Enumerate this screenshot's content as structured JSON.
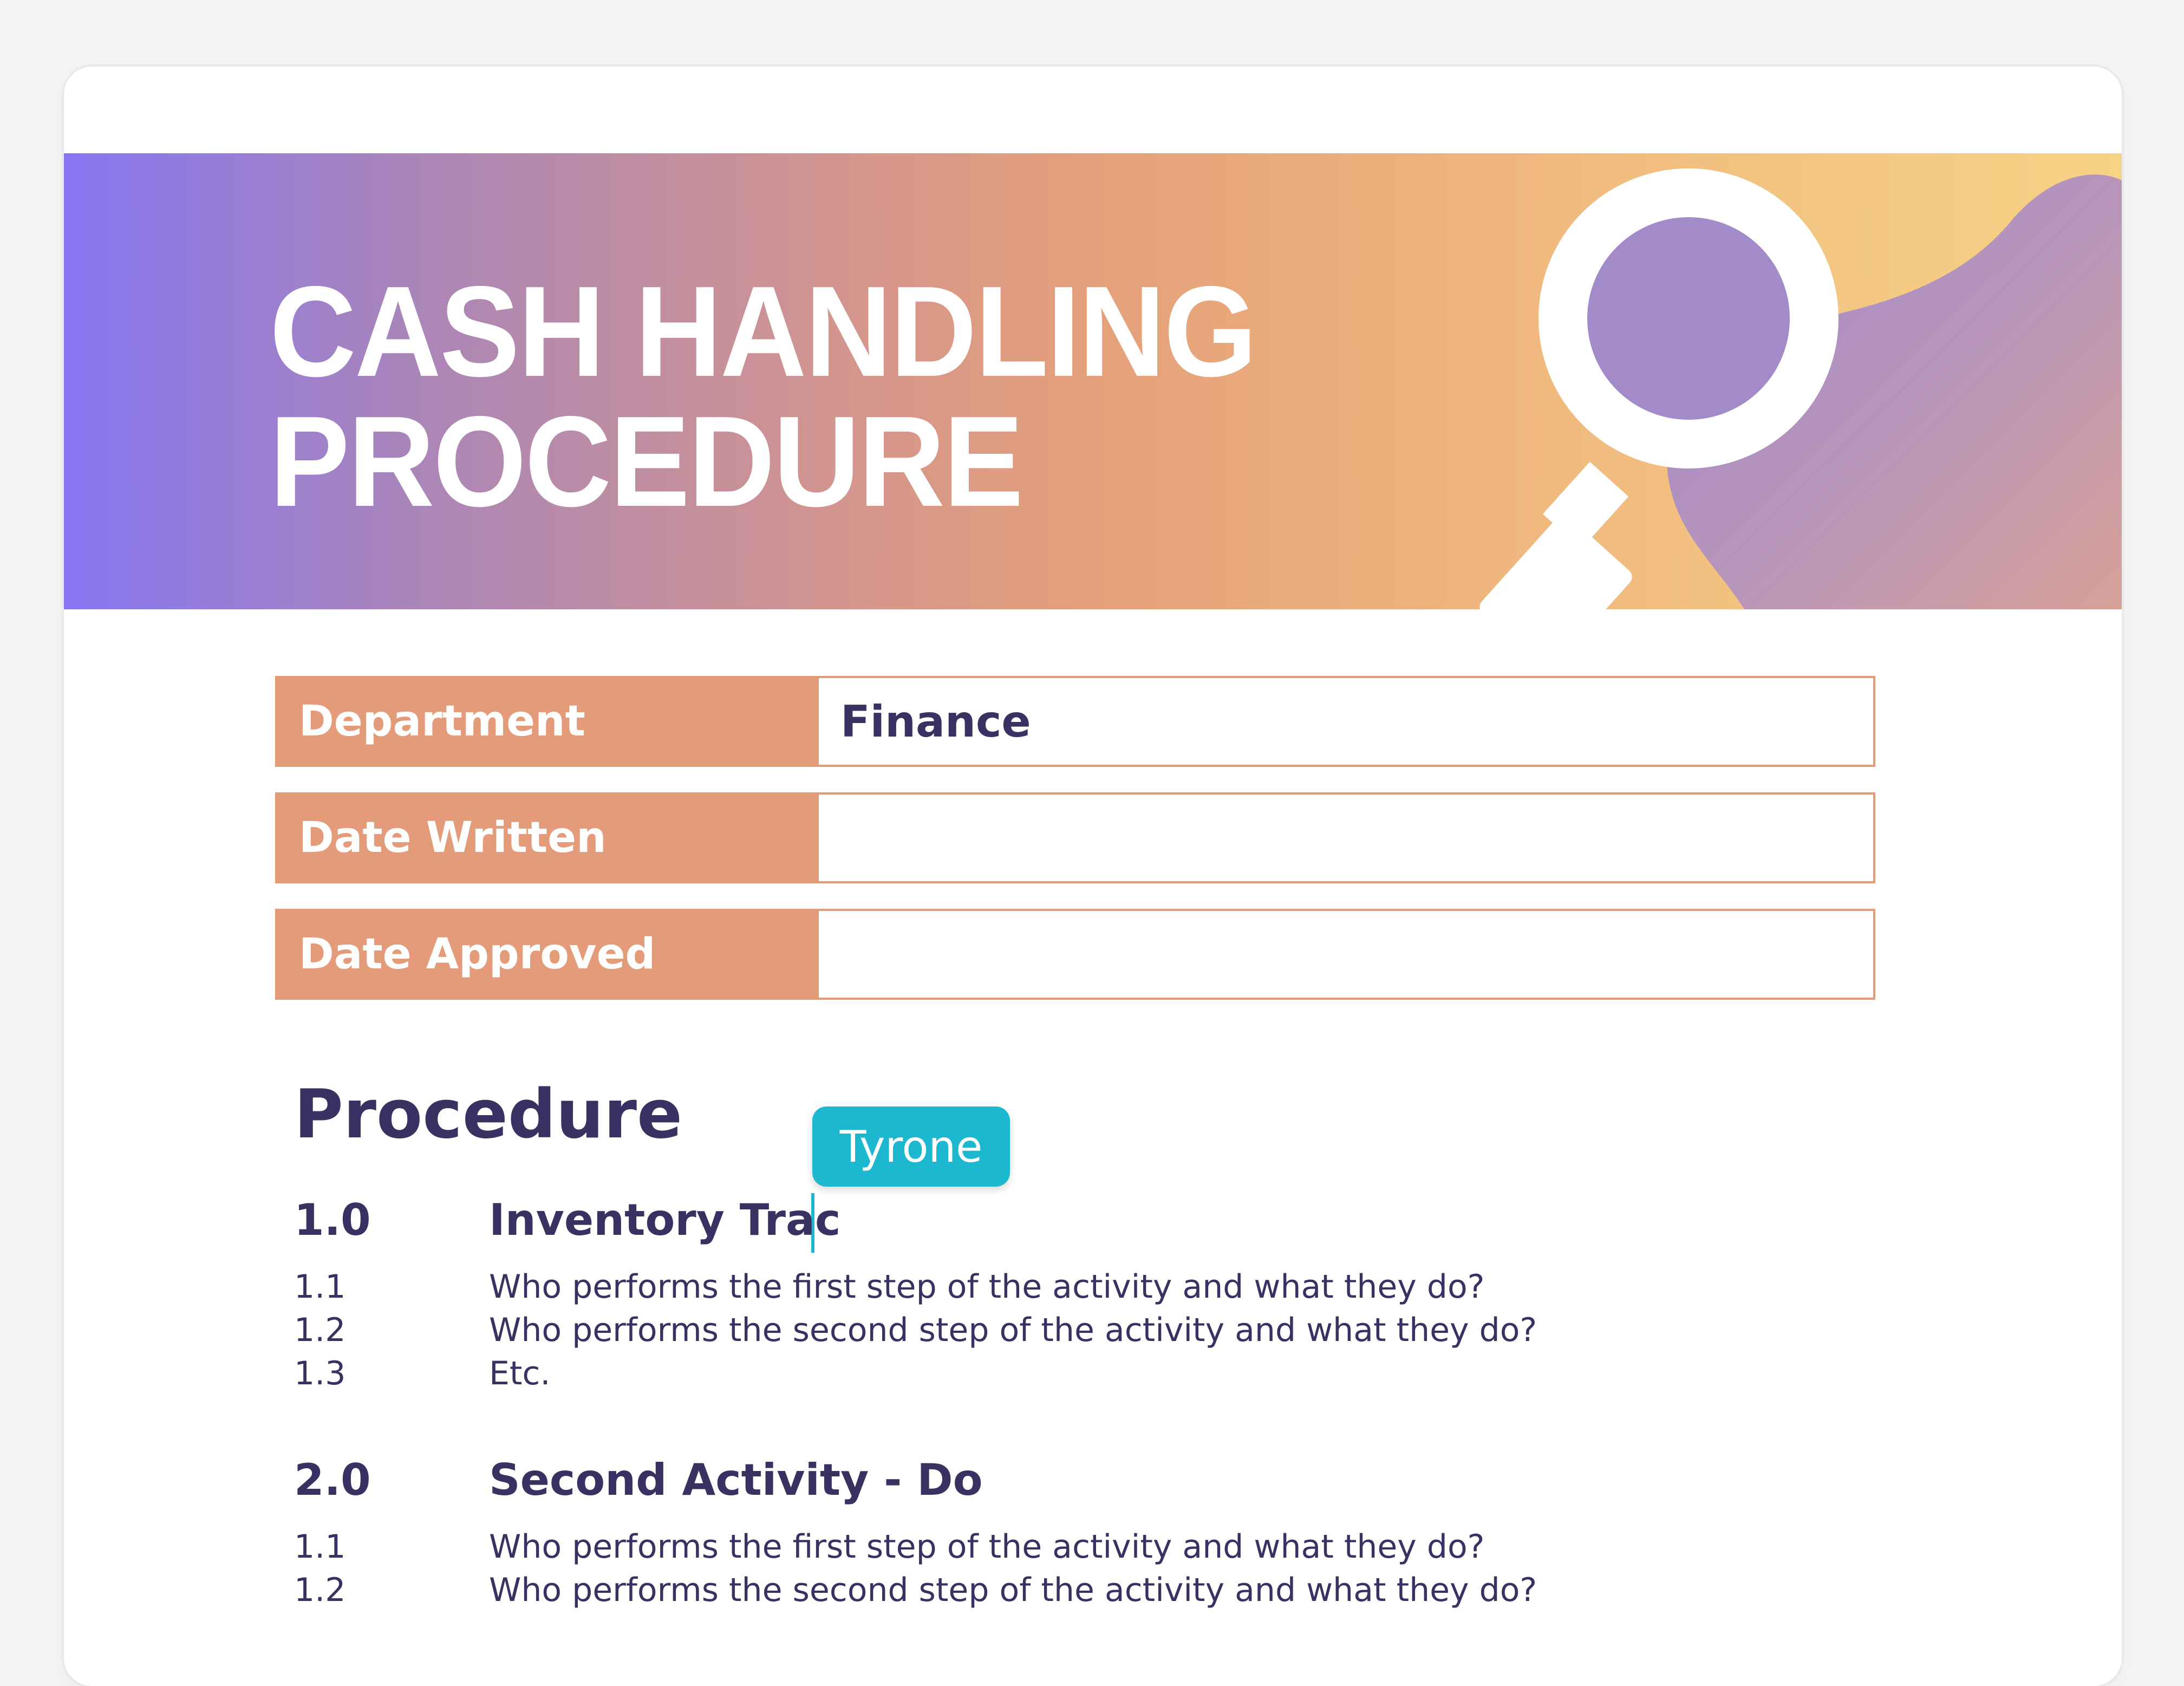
{
  "header": {
    "title_line1": "CASH HANDLING",
    "title_line2": "PROCEDURE",
    "icon": "magnifying-glass-icon"
  },
  "meta": [
    {
      "label": "Department",
      "value": "Finance"
    },
    {
      "label": "Date Written",
      "value": ""
    },
    {
      "label": "Date Approved",
      "value": ""
    }
  ],
  "procedure": {
    "heading": "Procedure",
    "activities": [
      {
        "number": "1.0",
        "title": "Inventory Trac",
        "steps": [
          {
            "number": "1.1",
            "text": "Who performs the first step of the activity and what they do?"
          },
          {
            "number": "1.2",
            "text": "Who performs the second step of the activity and what they do?"
          },
          {
            "number": "1.3",
            "text": "Etc."
          }
        ]
      },
      {
        "number": "2.0",
        "title": "Second Activity - Do",
        "steps": [
          {
            "number": "1.1",
            "text": "Who performs the first step of the activity and what they do?"
          },
          {
            "number": "1.2",
            "text": "Who performs the second step of the activity and what they do?"
          }
        ]
      }
    ]
  },
  "collaborator": {
    "name": "Tyrone",
    "color": "#1bb8cf"
  },
  "colors": {
    "accent": "#e49b7a",
    "text": "#3a3163"
  }
}
